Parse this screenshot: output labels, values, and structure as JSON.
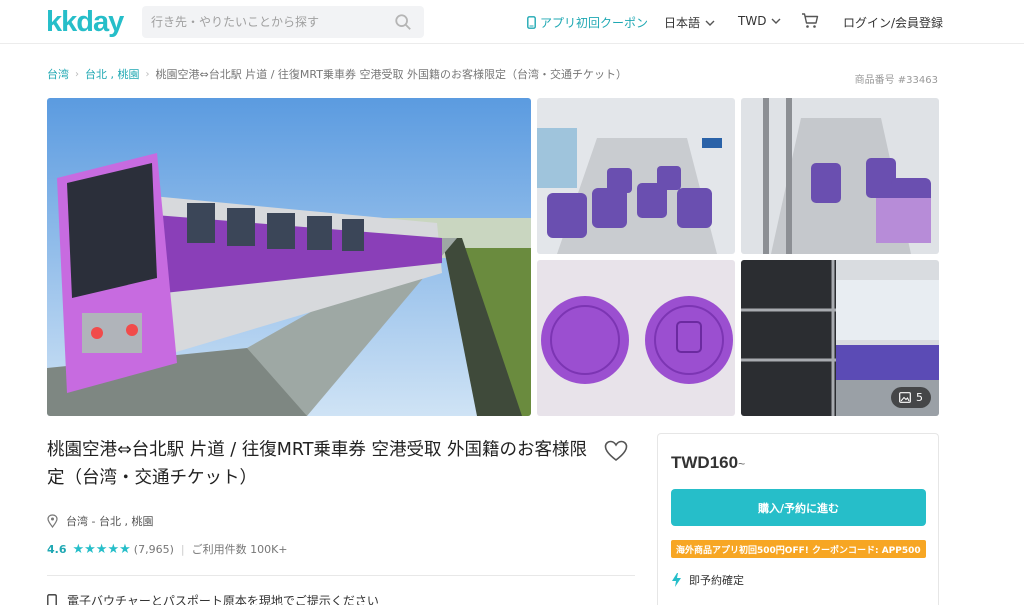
{
  "header": {
    "logo": "kkday",
    "search_placeholder": "行き先・やりたいことから探す",
    "coupon_label": "アプリ初回クーポン",
    "language_label": "日本語",
    "currency_label": "TWD",
    "login_label": "ログイン/会員登録"
  },
  "breadcrumb": {
    "items": [
      "台湾",
      "台北 , 桃園",
      "桃園空港⇔台北駅 片道 / 往復MRT乗車券 空港受取 外国籍のお客様限定（台湾・交通チケット）"
    ]
  },
  "product_number": "商品番号 #33463",
  "gallery": {
    "photo_count": "5"
  },
  "product": {
    "title": "桃園空港⇔台北駅 片道 / 往復MRT乗車券 空港受取 外国籍のお客様限定（台湾・交通チケット）",
    "location": "台湾 - 台北 , 桃園",
    "rating_score": "4.6",
    "stars": "★★★★★",
    "review_count": "(7,965)",
    "usage": "ご利用件数 100K+",
    "voucher_text": "電子バウチャーとパスポート原本を現地でご提示ください"
  },
  "booking": {
    "price": "TWD160",
    "price_suffix": "~",
    "buy_label": "購入/予約に進む",
    "promo_text": "海外商品アプリ初回500円OFF! クーポンコード: APP500",
    "instant_label": "即予約確定"
  },
  "colors": {
    "brand": "#26bec9",
    "promo": "#f7a623"
  },
  "icons": [
    "search-icon",
    "phone-icon",
    "chevron-down-icon",
    "cart-icon",
    "heart-icon",
    "location-pin-icon",
    "image-icon",
    "lightning-icon",
    "voucher-icon"
  ]
}
